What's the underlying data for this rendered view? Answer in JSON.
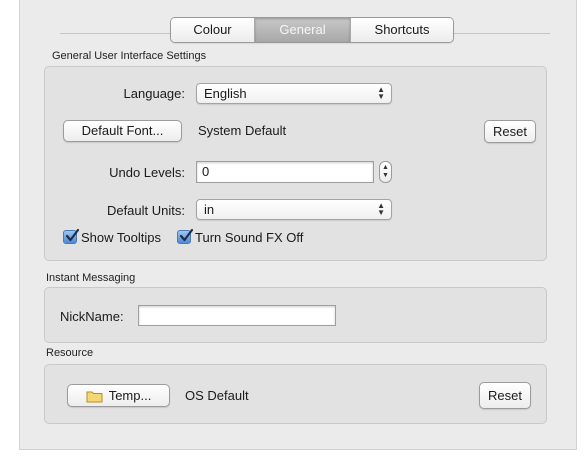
{
  "tabs": [
    {
      "label": "Colour",
      "active": false
    },
    {
      "label": "General",
      "active": true
    },
    {
      "label": "Shortcuts",
      "active": false
    }
  ],
  "general_ui": {
    "title": "General User Interface Settings",
    "language_label": "Language:",
    "language_value": "English",
    "default_font_button": "Default Font...",
    "default_font_value": "System Default",
    "reset_button": "Reset",
    "undo_levels_label": "Undo Levels:",
    "undo_levels_value": "0",
    "default_units_label": "Default Units:",
    "default_units_value": "in",
    "show_tooltips_label": "Show Tooltips",
    "show_tooltips_checked": true,
    "sound_fx_label": "Turn Sound FX Off",
    "sound_fx_checked": true
  },
  "instant_messaging": {
    "title": "Instant Messaging",
    "nickname_label": "NickName:",
    "nickname_value": ""
  },
  "resource": {
    "title": "Resource",
    "temp_button": "Temp...",
    "temp_value": "OS Default",
    "reset_button": "Reset"
  },
  "colors": {
    "panel_bg": "#ebebeb",
    "group_bg": "#e2e2e2",
    "checkbox_blue": "#4c8ad6"
  }
}
